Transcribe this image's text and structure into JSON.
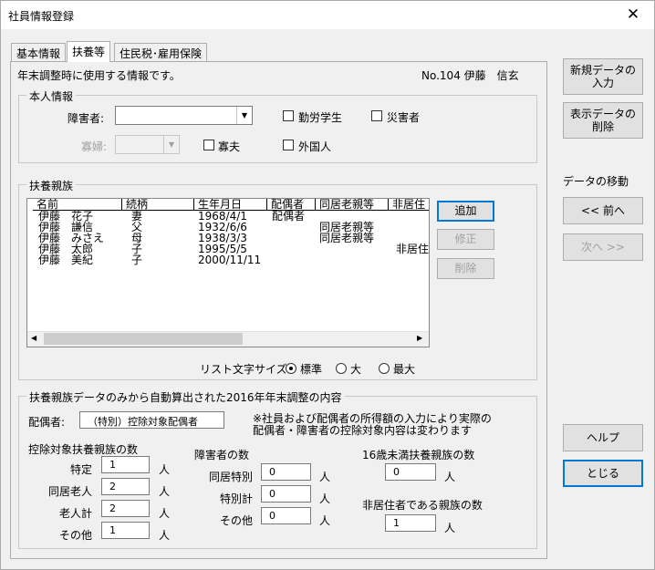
{
  "window": {
    "title": "社員情報登録",
    "close": "✕"
  },
  "tabs": [
    {
      "label": "基本情報"
    },
    {
      "label": "扶養等"
    },
    {
      "label": "住民税･雇用保険"
    }
  ],
  "panel": {
    "info_text": "年末調整時に使用する情報です。",
    "employee_no": "No.104 伊藤　信玄"
  },
  "honnin": {
    "title": "本人情報",
    "shogaisha_label": "障害者:",
    "shogaisha_value": "",
    "kafu_label": "寡婦:",
    "kafu_value": "",
    "kinro_label": "勤労学生",
    "saigai_label": "災害者",
    "kafu2_label": "寡夫",
    "gaikoku_label": "外国人"
  },
  "fuyo": {
    "title": "扶養親族",
    "columns": [
      "名前",
      "続柄",
      "生年月日",
      "配偶者",
      "同居老親等",
      "非居住"
    ],
    "rows": [
      [
        "伊藤　花子",
        "妻",
        "1968/4/1",
        "配偶者",
        "",
        ""
      ],
      [
        "伊藤　謙信",
        "父",
        "1932/6/6",
        "",
        "同居老親等",
        ""
      ],
      [
        "伊藤　みさえ",
        "母",
        "1938/3/3",
        "",
        "同居老親等",
        ""
      ],
      [
        "伊藤　太郎",
        "子",
        "1995/5/5",
        "",
        "",
        "非居住"
      ],
      [
        "伊藤　美紀",
        "子",
        "2000/11/11",
        "",
        "",
        ""
      ]
    ],
    "btn_add": "追加",
    "btn_edit": "修正",
    "btn_delete": "削除",
    "font_size_label": "リスト文字サイズ:",
    "size_normal": "標準",
    "size_large": "大",
    "size_xlarge": "最大"
  },
  "calc": {
    "title": "扶養親族データのみから自動算出された2016年年末調整の内容",
    "haigusha_label": "配偶者:",
    "haigusha_value": "（特別）控除対象配偶者",
    "note1": "※社員および配偶者の所得額の入力により実際の",
    "note2": "配偶者・障害者の控除対象内容は変わります",
    "koujo_title": "控除対象扶養親族の数",
    "tokutei_label": "特定",
    "tokutei_value": "1",
    "dokyo_rojin_label": "同居老人",
    "dokyo_rojin_value": "2",
    "rojin_kei_label": "老人計",
    "rojin_kei_value": "2",
    "sonota_label": "その他",
    "sonota_value": "1",
    "shogai_title": "障害者の数",
    "dokyo_tokubetsu_label": "同居特別",
    "dokyo_tokubetsu_value": "0",
    "tokubetsu_kei_label": "特別計",
    "tokubetsu_kei_value": "0",
    "shogai_sonota_label": "その他",
    "shogai_sonota_value": "0",
    "u16_title": "16歳未満扶養親族の数",
    "u16_value": "0",
    "hikyoju_title": "非居住者である親族の数",
    "hikyoju_value": "1",
    "unit": "人"
  },
  "side": {
    "new_line1": "新規データの",
    "new_line2": "入力",
    "del_line1": "表示データの",
    "del_line2": "削除",
    "nav_label": "データの移動",
    "prev": "<< 前へ",
    "next": "次へ >>",
    "help": "ヘルプ",
    "close": "とじる"
  }
}
